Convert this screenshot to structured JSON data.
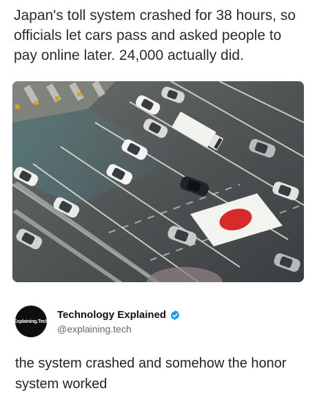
{
  "post": {
    "headline": "Japan's toll system crashed for 38 hours, so officials let cars pass and asked people to pay online later. 24,000 actually did.",
    "image": {
      "icon": "toll-plaza-photo"
    }
  },
  "author": {
    "avatar_text": "Explaining.Tech",
    "name": "Technology Explained",
    "handle": "@explaining.tech",
    "verified_icon": "verified-badge-icon",
    "verified_color": "#1d9bf0"
  },
  "reply": {
    "text": "the system crashed and somehow the honor system worked"
  }
}
